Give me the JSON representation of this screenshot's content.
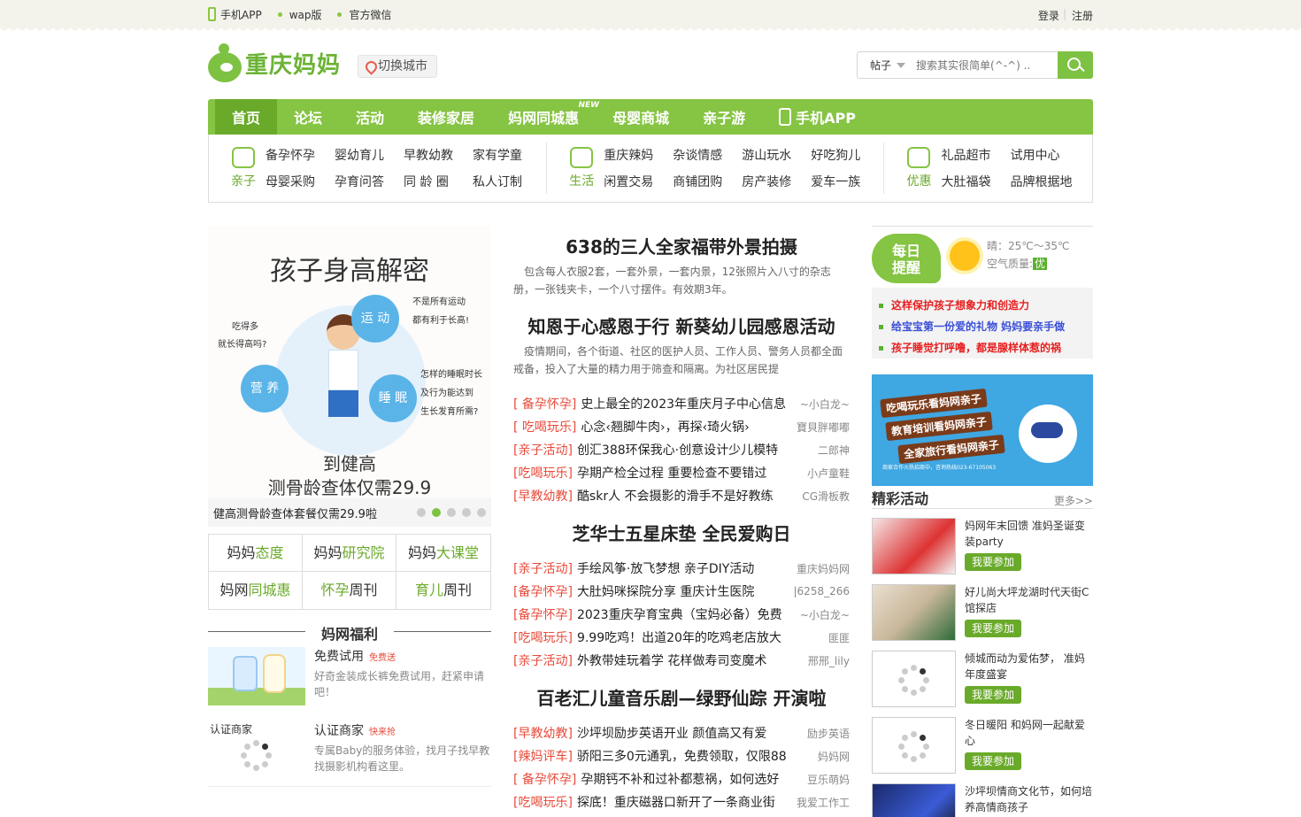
{
  "topbar": {
    "app": "手机APP",
    "wap": "wap版",
    "weixin": "官方微信",
    "login": "登录",
    "sep": "|",
    "register": "注册"
  },
  "header": {
    "logo": "重庆妈妈",
    "city": "切换城市",
    "search_type": "帖子",
    "search_placeholder": "搜索其实很简单(^-^) .."
  },
  "nav": [
    {
      "label": "首页"
    },
    {
      "label": "论坛"
    },
    {
      "label": "活动"
    },
    {
      "label": "装修家居"
    },
    {
      "label": "妈网同城惠",
      "badge": "NEW"
    },
    {
      "label": "母婴商城"
    },
    {
      "label": "亲子游"
    },
    {
      "label": "手机APP"
    }
  ],
  "subnav": {
    "groups": [
      {
        "name": "亲子",
        "links": [
          "备孕怀孕",
          "婴幼育儿",
          "早教幼教",
          "家有学童",
          "母婴采购",
          "孕育问答",
          "同 龄 圈",
          "私人订制"
        ]
      },
      {
        "name": "生活",
        "links": [
          "重庆辣妈",
          "杂谈情感",
          "游山玩水",
          "好吃狗儿",
          "闲置交易",
          "商铺团购",
          "房产装修",
          "爱车一族"
        ]
      },
      {
        "name": "优惠",
        "links": [
          "礼品超市",
          "试用中心",
          "大肚福袋",
          "品牌根据地"
        ]
      }
    ]
  },
  "banner": {
    "title": "孩子身高解密",
    "b1": "运 动",
    "b2": "营 养",
    "b3": "睡 眠",
    "l1": "吃得多",
    "l2": "就长得高吗?",
    "r1": "不是所有运动",
    "r2": "都有利于长高!",
    "r3": "怎样的睡眠时长",
    "r4": "及行为能达到",
    "r5": "生长发育所需?",
    "bottom1": "到健高",
    "bottom2": "测骨龄查体仅需29.9",
    "caption": "健高测骨龄查体套餐仅需29.9啦"
  },
  "mama_grid": [
    {
      "pre": "妈妈",
      "em": "态度"
    },
    {
      "pre": "妈妈",
      "em": "研究院"
    },
    {
      "pre": "妈妈",
      "em": "大课堂"
    },
    {
      "pre": "妈网",
      "em": "同城惠"
    },
    {
      "em": "怀孕",
      "post": "周刊"
    },
    {
      "em": "育儿",
      "post": "周刊"
    }
  ],
  "fuli": {
    "title": "妈网福利",
    "items": [
      {
        "title": "免费试用",
        "tag": "免费送",
        "desc": "好奇金装成长裤免费试用，赶紧申请吧！"
      },
      {
        "title": "认证商家",
        "tag": "快来抢",
        "desc": "专属Baby的服务体验，找月子找早教找摄影机构看这里。",
        "img_alt": "认证商家"
      }
    ]
  },
  "headlines": [
    {
      "title": "638的三人全家福带外景拍摄",
      "desc": "包含每人衣服2套，一套外景，一套内景，12张照片入八寸的杂志册，一张钱夹卡，一个八寸摆件。有效期3年。"
    },
    {
      "title": "知恩于心感恩于行 新葵幼儿园感恩活动",
      "desc": "疫情期间，各个街道、社区的医护人员、工作人员、警务人员都全面戒备，投入了大量的精力用于筛查和隔离。为社区居民提"
    }
  ],
  "news1": [
    {
      "cat": "[ 备孕怀孕]",
      "title": "史上最全的2023年重庆月子中心信息",
      "author": "~小白龙~"
    },
    {
      "cat": "[ 吃喝玩乐]",
      "title": "心念‹翘脚牛肉›，再探‹琦火锅›",
      "author": "寶貝胖嘟嘟"
    },
    {
      "cat": "[亲子活动]",
      "title": "创汇388环保我心·创意设计少儿模特",
      "author": "二郎神"
    },
    {
      "cat": "[吃喝玩乐]",
      "title": "孕期产检全过程 重要检查不要错过",
      "author": "小卢童鞋"
    },
    {
      "cat": "[早教幼教]",
      "title": "酷skr人 不会摄影的滑手不是好教练",
      "author": "CG滑板教"
    }
  ],
  "headline3": "芝华士五星床垫 全民爱购日",
  "news2": [
    {
      "cat": "[亲子活动]",
      "title": "手绘风筝·放飞梦想 亲子DIY活动",
      "author": "重庆妈妈网"
    },
    {
      "cat": "[备孕怀孕]",
      "title": "大肚妈咪探院分享 重庆计生医院",
      "author": "|6258_266"
    },
    {
      "cat": "[备孕怀孕]",
      "title": "2023重庆孕育宝典（宝妈必备）免费",
      "author": "~小白龙~"
    },
    {
      "cat": "[吃喝玩乐]",
      "title": "9.99吃鸡！出道20年的吃鸡老店放大",
      "author": "匪匪"
    },
    {
      "cat": "[亲子活动]",
      "title": "外教带娃玩着学 花样做寿司变魔术",
      "author": "邢邢_lily"
    }
  ],
  "headline4": "百老汇儿童音乐剧—绿野仙踪 开演啦",
  "news3": [
    {
      "cat": "[早教幼教]",
      "title": "沙坪坝励步英语开业 颜值高又有爱",
      "author": "励步英语"
    },
    {
      "cat": "[辣妈评车]",
      "title": "骄阳三多0元通乳，免费领取，仅限88",
      "author": "妈妈网"
    },
    {
      "cat": "[ 备孕怀孕]",
      "title": "孕期钙不补和过补都惹祸，如何选好",
      "author": "豆乐萌妈"
    },
    {
      "cat": "[吃喝玩乐]",
      "title": "探底！重庆磁器口新开了一条商业街",
      "author": "我爱工作工"
    }
  ],
  "daily": {
    "label1": "每日",
    "label2": "提醒",
    "weather": "晴：25℃～35℃",
    "aq_label": "空气质量:",
    "aq": "优"
  },
  "tips": [
    {
      "text": "这样保护孩子想象力和创造力",
      "color": "red"
    },
    {
      "text": "给宝宝第一份爱的礼物 妈妈要亲手做",
      "color": "blue"
    },
    {
      "text": "孩子睡觉打呼噜，都是腺样体惹的祸",
      "color": "red"
    }
  ],
  "ad": {
    "s1": "吃喝玩乐看妈网亲子",
    "s2": "教育培训看妈网亲子",
    "s3": "全家旅行看妈网亲子",
    "tail": "商家合作火热招商中，咨询热线023-67105063"
  },
  "activities": {
    "title": "精彩活动",
    "more": "更多>>",
    "join": "我要参加",
    "items": [
      {
        "title": "妈网年末回馈 准妈圣诞变装party"
      },
      {
        "title": "好儿尚大坪龙湖时代天街C馆探店"
      },
      {
        "title": "倾城而动为爱佑梦， 准妈年度盛宴"
      },
      {
        "title": "冬日暖阳 和妈网一起献爱心"
      },
      {
        "title": "沙坪坝情商文化节，如何培养高情商孩子"
      }
    ]
  },
  "colors": {
    "green": "#86c443",
    "dark_green": "#6aaa2a",
    "red": "#e84a3a"
  }
}
